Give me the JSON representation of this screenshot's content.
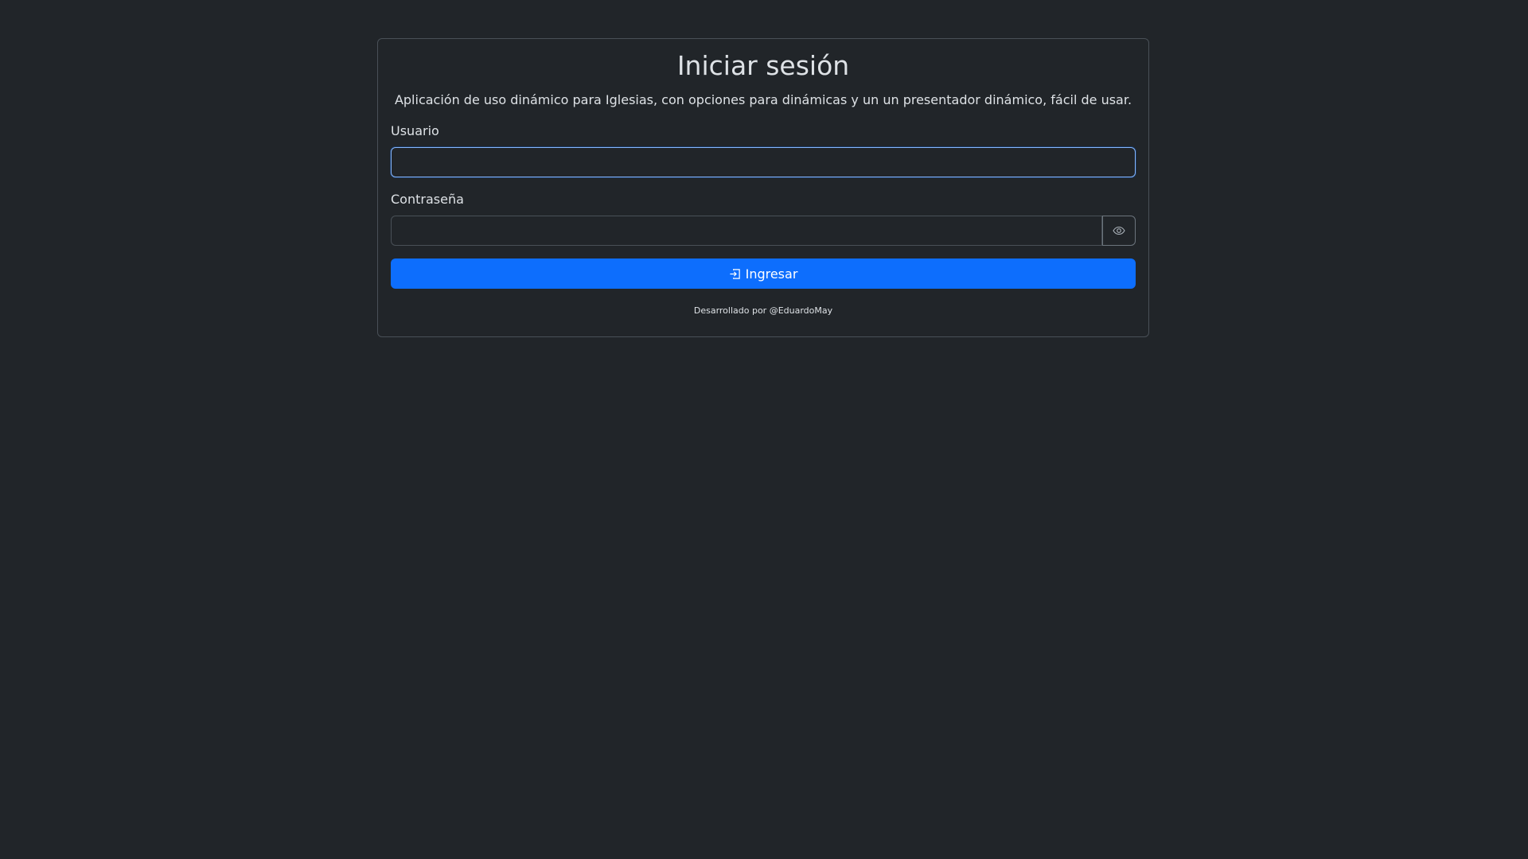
{
  "login": {
    "title": "Iniciar sesión",
    "subtitle": "Aplicación de uso dinámico para Iglesias, con opciones para dinámicas y un un presentador dinámico, fácil de usar.",
    "username_label": "Usuario",
    "username_value": "",
    "password_label": "Contraseña",
    "password_value": "",
    "toggle_password_icon": "eye-icon",
    "submit_icon": "sign-in-icon",
    "submit_label": "Ingresar",
    "footer": "Desarrollado por @EduardoMay"
  },
  "colors": {
    "background": "#212529",
    "primary": "#0d6efd",
    "focus_border": "#86b7fe",
    "border": "#495057"
  }
}
